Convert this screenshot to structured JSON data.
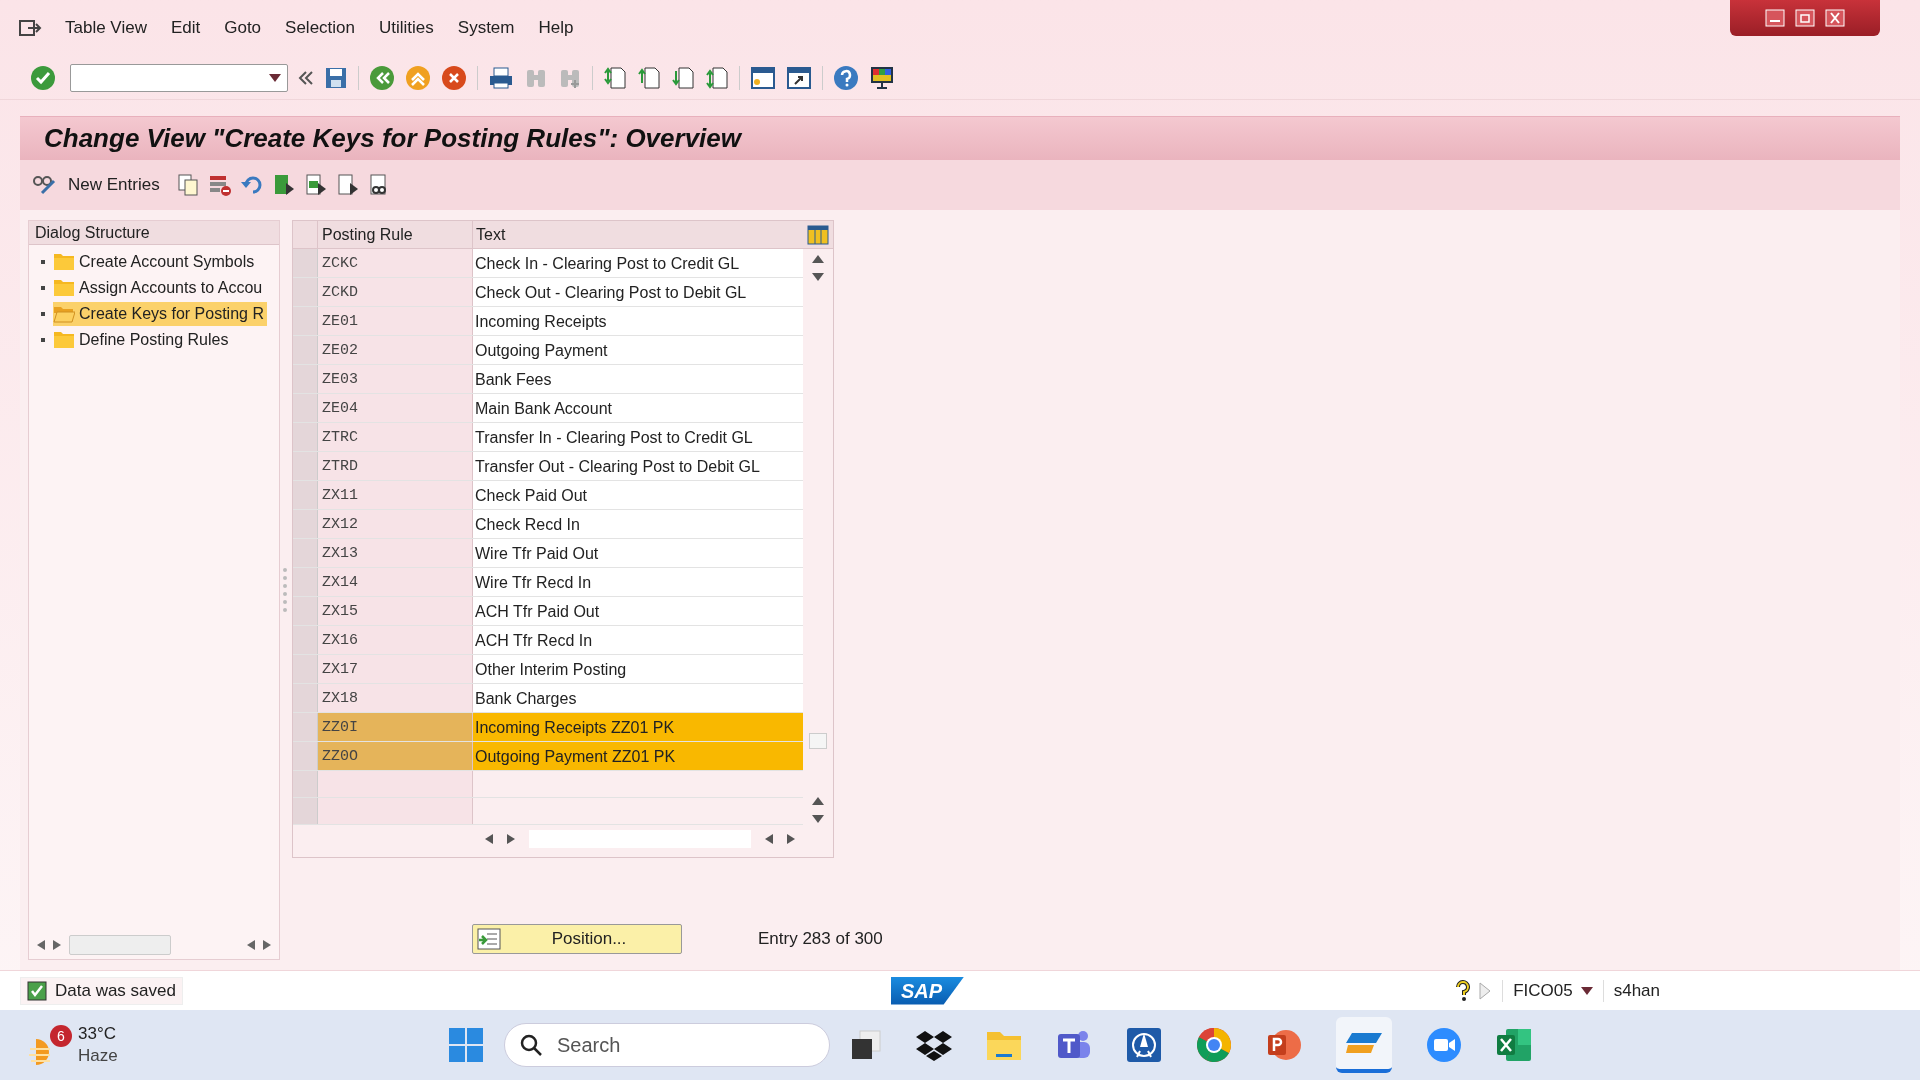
{
  "menu": [
    "Table View",
    "Edit",
    "Goto",
    "Selection",
    "Utilities",
    "System",
    "Help"
  ],
  "title": "Change View \"Create Keys for Posting Rules\": Overview",
  "app_toolbar": {
    "new_entries": "New Entries"
  },
  "dialog_structure": {
    "header": "Dialog Structure",
    "items": [
      {
        "label": "Create Account Symbols",
        "selected": false
      },
      {
        "label": "Assign Accounts to Accou",
        "selected": false
      },
      {
        "label": "Create Keys for Posting R",
        "selected": true
      },
      {
        "label": "Define Posting Rules",
        "selected": false
      }
    ]
  },
  "table": {
    "columns": [
      "Posting Rule",
      "Text"
    ],
    "rows": [
      {
        "rule": "ZCKC",
        "text": "Check In  - Clearing Post to Credit GL",
        "selected": false
      },
      {
        "rule": "ZCKD",
        "text": "Check Out  - Clearing Post to Debit GL",
        "selected": false
      },
      {
        "rule": "ZE01",
        "text": "Incoming Receipts",
        "selected": false
      },
      {
        "rule": "ZE02",
        "text": "Outgoing Payment",
        "selected": false
      },
      {
        "rule": "ZE03",
        "text": "Bank Fees",
        "selected": false
      },
      {
        "rule": "ZE04",
        "text": "Main Bank Account",
        "selected": false
      },
      {
        "rule": "ZTRC",
        "text": "Transfer In - Clearing Post to Credit GL",
        "selected": false
      },
      {
        "rule": "ZTRD",
        "text": "Transfer Out - Clearing Post to Debit GL",
        "selected": false
      },
      {
        "rule": "ZX11",
        "text": "Check Paid Out",
        "selected": false
      },
      {
        "rule": "ZX12",
        "text": "Check Recd In",
        "selected": false
      },
      {
        "rule": "ZX13",
        "text": "Wire Tfr Paid Out",
        "selected": false
      },
      {
        "rule": "ZX14",
        "text": "Wire Tfr Recd In",
        "selected": false
      },
      {
        "rule": "ZX15",
        "text": "ACH Tfr Paid Out",
        "selected": false
      },
      {
        "rule": "ZX16",
        "text": "ACH Tfr Recd In",
        "selected": false
      },
      {
        "rule": "ZX17",
        "text": "Other Interim Posting",
        "selected": false
      },
      {
        "rule": "ZX18",
        "text": "Bank Charges",
        "selected": false
      },
      {
        "rule": "ZZ0I",
        "text": "Incoming Receipts ZZ01 PK",
        "selected": true
      },
      {
        "rule": "ZZ0O",
        "text": "Outgoing Payment ZZ01 PK",
        "selected": true
      }
    ]
  },
  "position_button": "Position...",
  "entry_info": "Entry 283 of 300",
  "status_bar": {
    "message": "Data was saved",
    "sap_logo": "SAP",
    "system": "FICO05",
    "server": "s4han"
  },
  "taskbar": {
    "weather_badge": "6",
    "temperature": "33°C",
    "condition": "Haze",
    "search": {
      "placeholder": "Search"
    }
  }
}
